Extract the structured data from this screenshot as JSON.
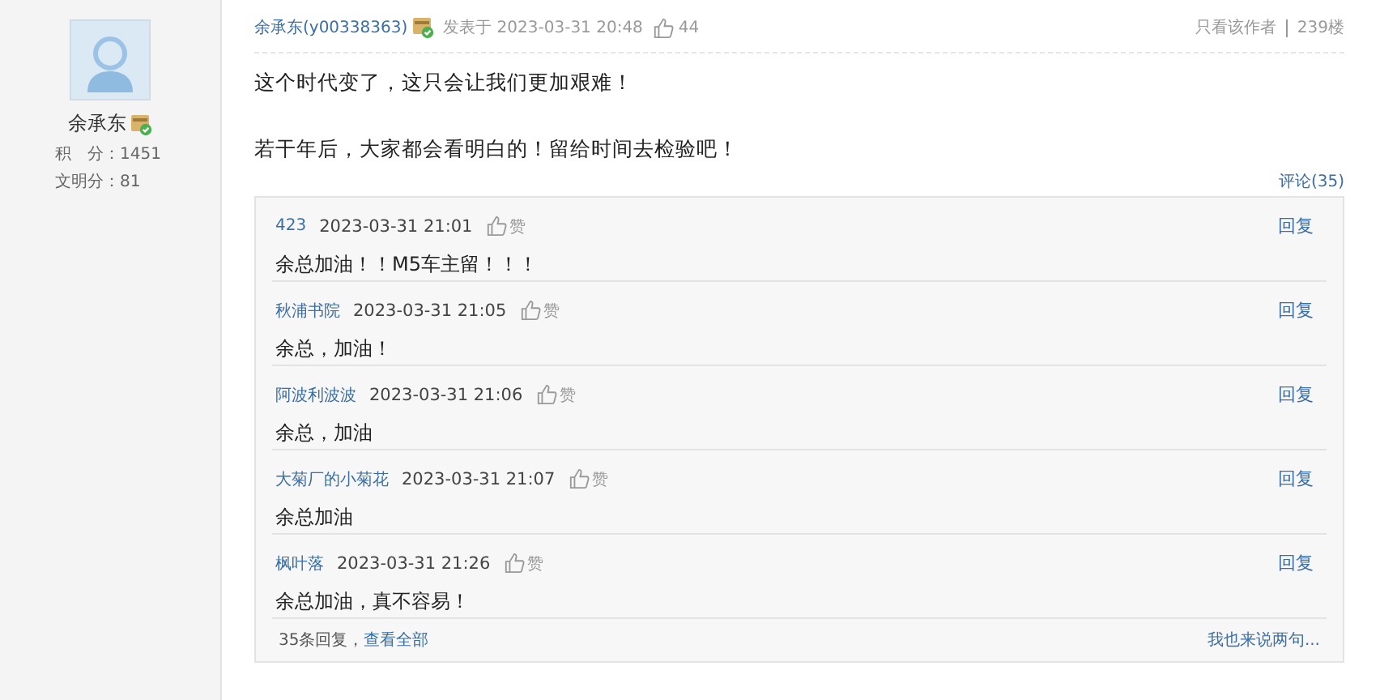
{
  "author": {
    "name": "余承东",
    "points_label": "积　分：",
    "points": "1451",
    "civility_label": "文明分：",
    "civility": "81"
  },
  "post": {
    "author_link": "余承东(y00338363)",
    "posted": "发表于 2023-03-31 20:48",
    "likes": "44",
    "only_author": "只看该作者",
    "floor": "239楼",
    "paragraphs": [
      "这个时代变了，这只会让我们更加艰难！",
      "若干年后，大家都会看明白的！留给时间去检验吧！"
    ],
    "comments_link": "评论(35)"
  },
  "comments": [
    {
      "user": "423",
      "time": "2023-03-31 21:01",
      "like": "赞",
      "reply": "回复",
      "text": "余总加油！！M5车主留！！！"
    },
    {
      "user": "秋浦书院",
      "time": "2023-03-31 21:05",
      "like": "赞",
      "reply": "回复",
      "text": "余总，加油！"
    },
    {
      "user": "阿波利波波",
      "time": "2023-03-31 21:06",
      "like": "赞",
      "reply": "回复",
      "text": "余总，加油"
    },
    {
      "user": "大菊厂的小菊花",
      "time": "2023-03-31 21:07",
      "like": "赞",
      "reply": "回复",
      "text": "余总加油"
    },
    {
      "user": "枫叶落",
      "time": "2023-03-31 21:26",
      "like": "赞",
      "reply": "回复",
      "text": "余总加油，真不容易！"
    }
  ],
  "footer": {
    "count": "35条回复，",
    "view_all": "查看全部",
    "write": "我也来说两句..."
  }
}
